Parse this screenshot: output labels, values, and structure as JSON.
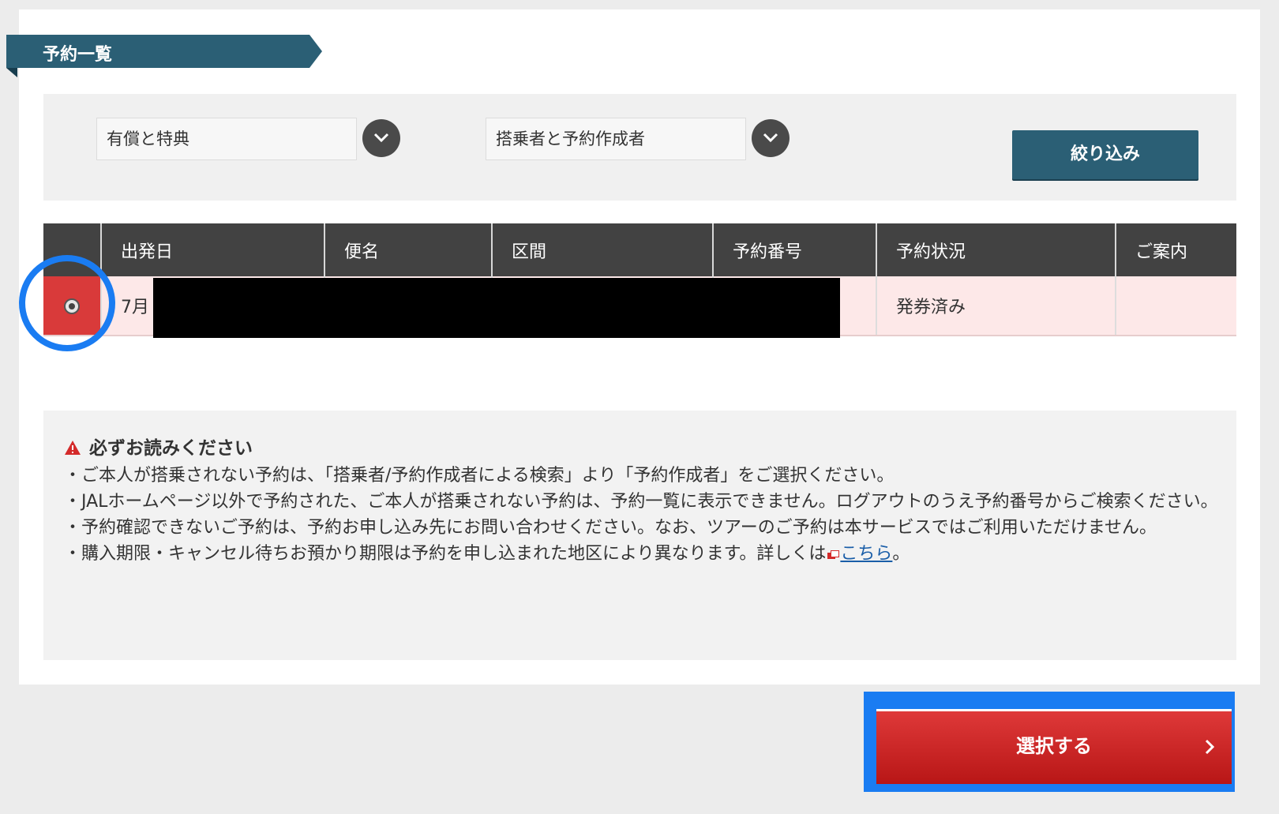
{
  "section": {
    "title": "予約一覧"
  },
  "filters": {
    "ticket_type": "有償と特典",
    "person_type": "搭乗者と予約作成者",
    "filter_button": "絞り込み"
  },
  "table": {
    "headers": [
      "出発日",
      "便名",
      "区間",
      "予約番号",
      "予約状況",
      "ご案内"
    ],
    "rows": [
      {
        "date": "7月",
        "flight": "",
        "route": "",
        "booking_no": "",
        "status": "発券済み",
        "info": ""
      }
    ]
  },
  "notice": {
    "heading": "必ずお読みください",
    "items": [
      "ご本人が搭乗されない予約は、「搭乗者/予約作成者による検索」より「予約作成者」をご選択ください。",
      "JALホームページ以外で予約された、ご本人が搭乗されない予約は、予約一覧に表示できません。ログアウトのうえ予約番号からご検索ください。",
      "予約確認できないご予約は、予約お申し込み先にお問い合わせください。なお、ツアーのご予約は本サービスではご利用いただけません。"
    ],
    "last_item_prefix": "購入期限・キャンセル待ちお預かり期限は予約を申し込まれた地区により異なります。詳しくは",
    "link_text": "こちら",
    "last_item_suffix": "。"
  },
  "actions": {
    "select_button": "選択する"
  },
  "colors": {
    "brand_teal": "#2b5f75",
    "accent_red": "#d93a3a",
    "highlight_blue": "#1a7cf2",
    "row_pink": "#fde8e8"
  }
}
